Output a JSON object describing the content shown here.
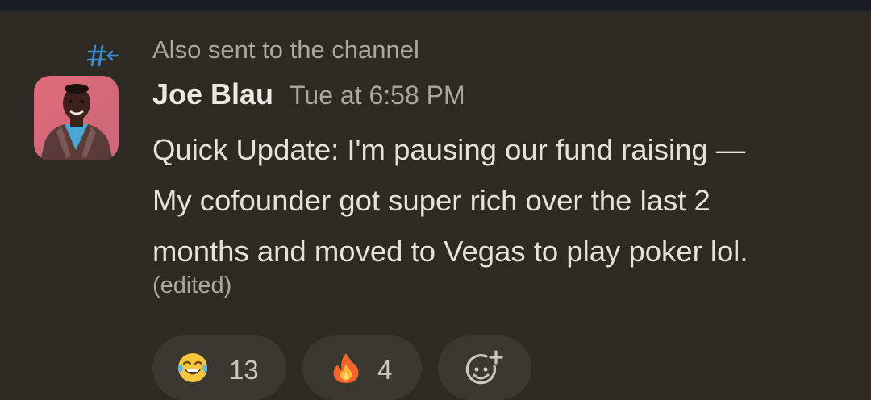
{
  "message": {
    "thread_notice": "Also sent to the channel",
    "thread_icon": "thread-hash-arrow-icon",
    "author": "Joe Blau",
    "timestamp": "Tue at 6:58 PM",
    "body_lines": [
      "Quick Update: I'm pausing our fund raising —",
      "My cofounder got super rich over the last 2",
      "months and moved to Vegas to play poker lol."
    ],
    "edited_label": "(edited)"
  },
  "reactions": [
    {
      "emoji": "face-with-tears-of-joy",
      "count": "13"
    },
    {
      "emoji": "fire",
      "count": "4"
    }
  ],
  "add_reaction_icon": "add-emoji-icon",
  "colors": {
    "background": "#2d2a23",
    "top_bar": "#1a1d23",
    "thread_icon": "#3b8fd6",
    "reaction_pill": "#3b3831"
  }
}
